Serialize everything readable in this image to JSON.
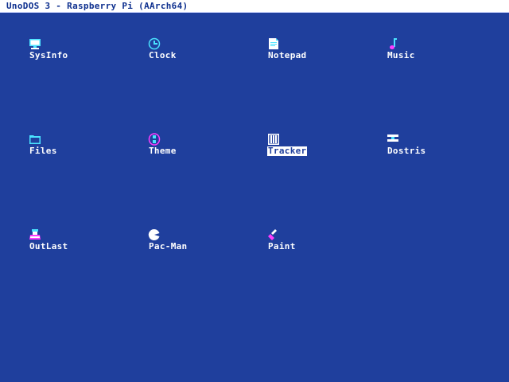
{
  "window": {
    "title": "UnoDOS 3 - Raspberry Pi (AArch64)"
  },
  "theme": {
    "desktop_bg": "#1f3f9d",
    "titlebar_bg": "#ffffff",
    "title_text": "#0d2f8e",
    "label_text": "#ffffff",
    "cyan": "#4ae3ff",
    "magenta": "#ff3cff"
  },
  "desktop": {
    "icons": [
      {
        "label": "SysInfo",
        "icon": "computer-icon",
        "selected": false
      },
      {
        "label": "Clock",
        "icon": "clock-icon",
        "selected": false
      },
      {
        "label": "Notepad",
        "icon": "notepad-icon",
        "selected": false
      },
      {
        "label": "Music",
        "icon": "music-note-icon",
        "selected": false
      },
      {
        "label": "Files",
        "icon": "folder-icon",
        "selected": false
      },
      {
        "label": "Theme",
        "icon": "palette-icon",
        "selected": false
      },
      {
        "label": "Tracker",
        "icon": "tracker-icon",
        "selected": true
      },
      {
        "label": "Dostris",
        "icon": "tetris-block-icon",
        "selected": false
      },
      {
        "label": "OutLast",
        "icon": "car-icon",
        "selected": false
      },
      {
        "label": "Pac-Man",
        "icon": "pacman-icon",
        "selected": false
      },
      {
        "label": "Paint",
        "icon": "paint-brush-icon",
        "selected": false
      }
    ]
  }
}
